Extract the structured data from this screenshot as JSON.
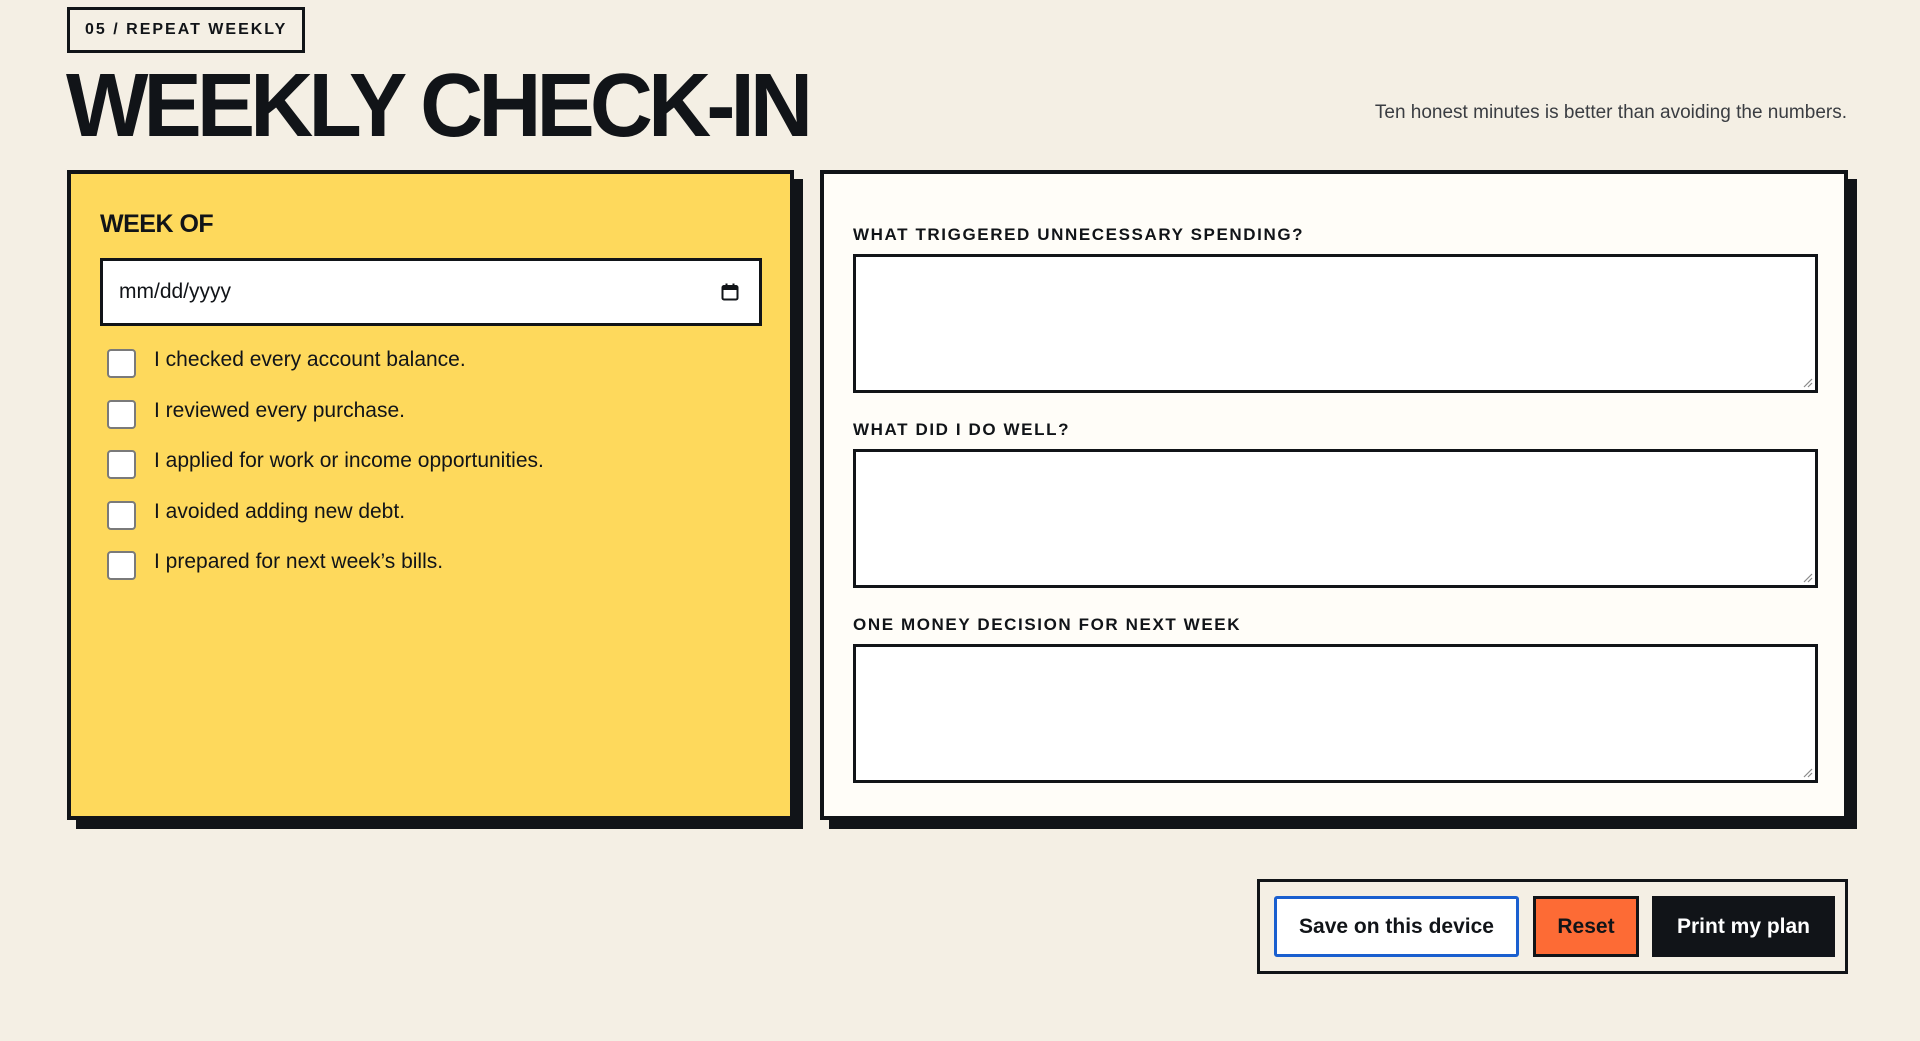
{
  "header": {
    "eyebrow": "05 / REPEAT WEEKLY",
    "title": "WEEKLY CHECK-IN",
    "tagline": "Ten honest minutes is better than avoiding the numbers."
  },
  "checklist_card": {
    "heading": "WEEK OF",
    "date_input": {
      "placeholder": "mm/dd/yyyy",
      "icon": "calendar-icon"
    },
    "items": [
      {
        "label": "I checked every account balance.",
        "checked": false
      },
      {
        "label": "I reviewed every purchase.",
        "checked": false
      },
      {
        "label": "I applied for work or income opportunities.",
        "checked": false
      },
      {
        "label": "I avoided adding new debt.",
        "checked": false
      },
      {
        "label": "I prepared for next week’s bills.",
        "checked": false
      }
    ]
  },
  "reflection_card": {
    "fields": [
      {
        "label": "WHAT TRIGGERED UNNECESSARY SPENDING?",
        "value": ""
      },
      {
        "label": "WHAT DID I DO WELL?",
        "value": ""
      },
      {
        "label": "ONE MONEY DECISION FOR NEXT WEEK",
        "value": ""
      }
    ]
  },
  "actions": {
    "save_label": "Save on this device",
    "reset_label": "Reset",
    "print_label": "Print my plan"
  },
  "colors": {
    "background": "#f4efe4",
    "card_yellow": "#fed95c",
    "ink": "#111418",
    "accent_blue": "#1a5fcf",
    "accent_orange": "#fd6b35"
  }
}
